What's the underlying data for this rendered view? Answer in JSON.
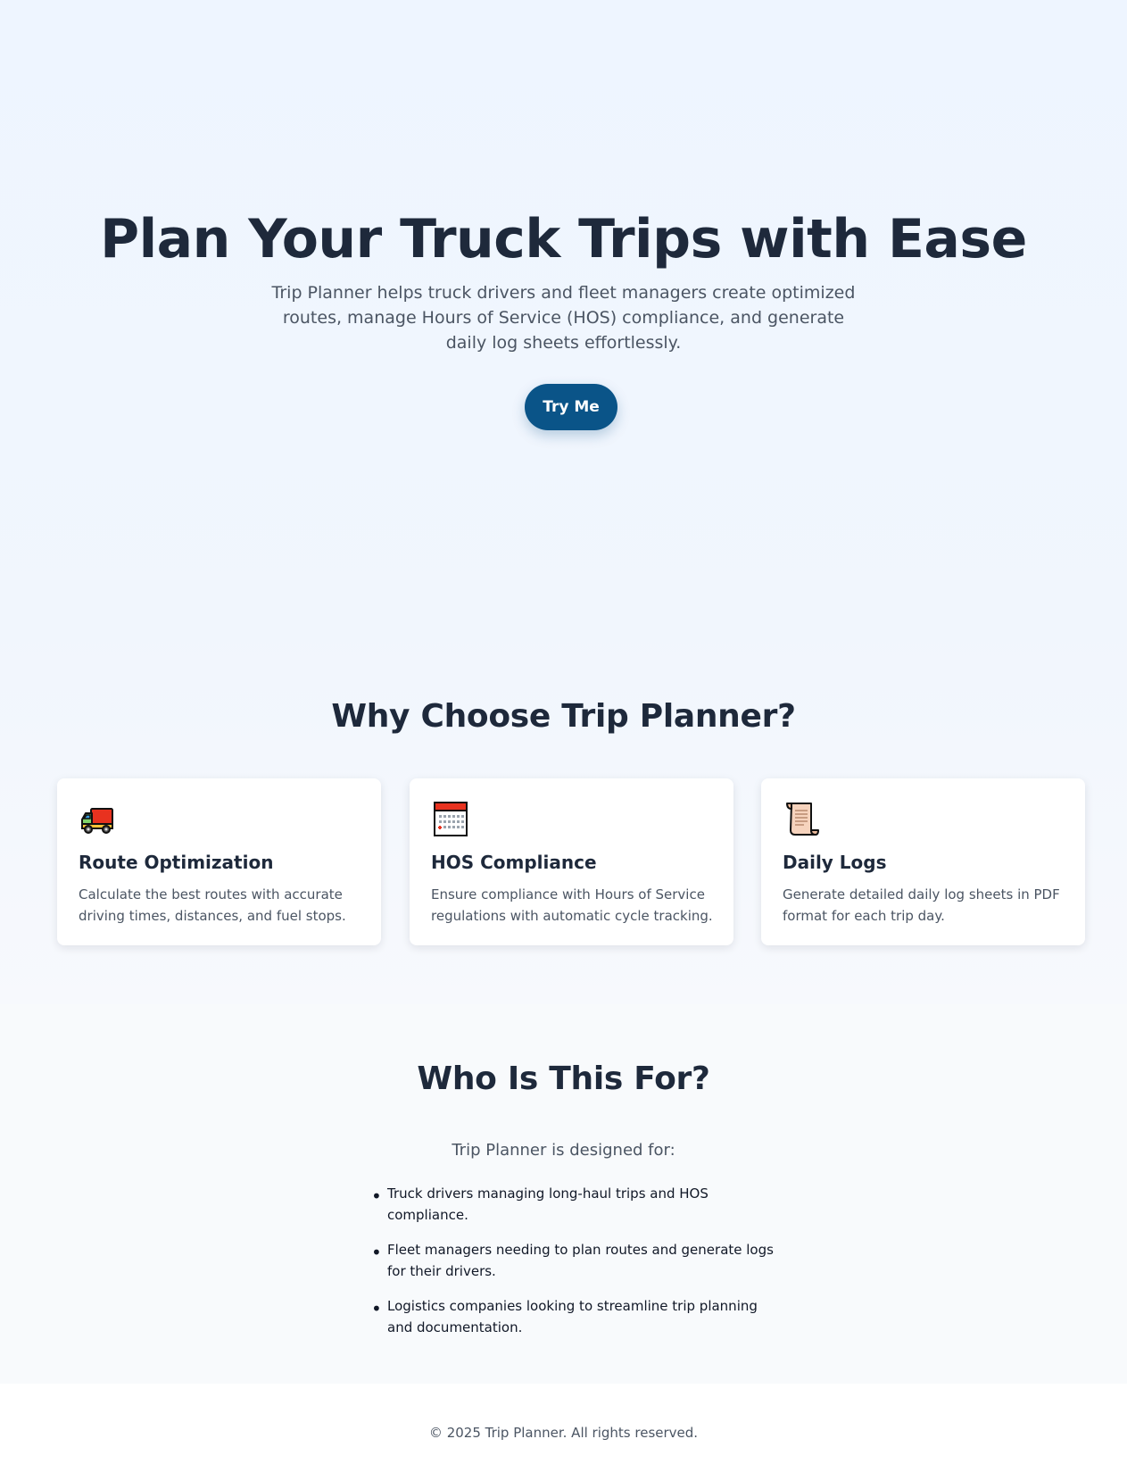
{
  "hero": {
    "title": "Plan Your Truck Trips with Ease",
    "subtitle": "Trip Planner helps truck drivers and fleet managers create optimized routes, manage Hours of Service (HOS) compliance, and generate daily log sheets effortlessly.",
    "cta_label": "Try Me"
  },
  "features": {
    "title": "Why Choose Trip Planner?",
    "cards": [
      {
        "icon": "delivery-truck-icon",
        "title": "Route Optimization",
        "text": "Calculate the best routes with accurate driving times, distances, and fuel stops."
      },
      {
        "icon": "calendar-icon",
        "title": "HOS Compliance",
        "text": "Ensure compliance with Hours of Service regulations with automatic cycle tracking."
      },
      {
        "icon": "scroll-icon",
        "title": "Daily Logs",
        "text": "Generate detailed daily log sheets in PDF format for each trip day."
      }
    ]
  },
  "audience": {
    "title": "Who Is This For?",
    "intro": "Trip Planner is designed for:",
    "items": [
      "Truck drivers managing long-haul trips and HOS compliance.",
      "Fleet managers needing to plan routes and generate logs for their drivers.",
      "Logistics companies looking to streamline trip planning and documentation."
    ]
  },
  "footer": {
    "text": "© 2025 Trip Planner. All rights reserved."
  },
  "colors": {
    "accent": "#0a5488",
    "heading": "#1e293b",
    "body_text": "#4b5563",
    "hero_background": "#eef5ff",
    "section_background": "#f8fafc"
  }
}
